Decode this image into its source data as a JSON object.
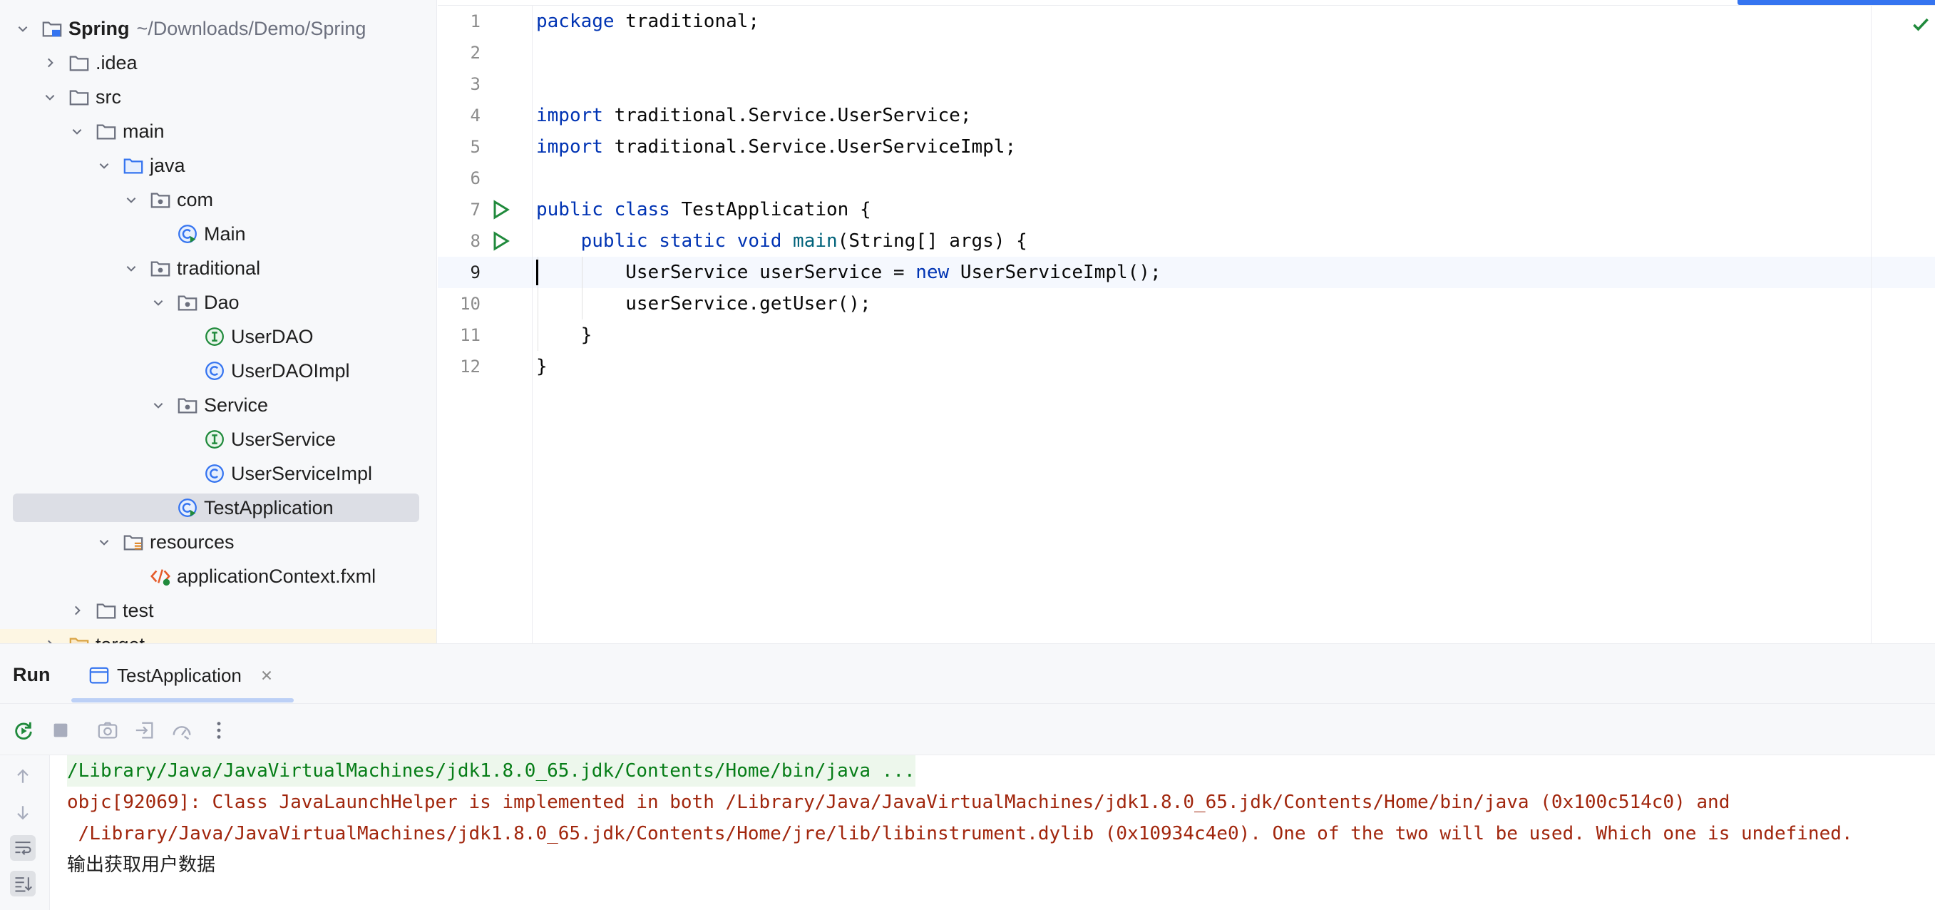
{
  "project_tree": {
    "root": {
      "name": "Spring",
      "path": "~/Downloads/Demo/Spring"
    },
    "items": [
      {
        "label": ".idea",
        "icon": "folder-icon"
      },
      {
        "label": "src",
        "icon": "folder-icon"
      },
      {
        "label": "main",
        "icon": "folder-icon"
      },
      {
        "label": "java",
        "icon": "source-folder-icon"
      },
      {
        "label": "com",
        "icon": "package-icon"
      },
      {
        "label": "Main",
        "icon": "runnable-class-icon"
      },
      {
        "label": "traditional",
        "icon": "package-icon"
      },
      {
        "label": "Dao",
        "icon": "package-icon"
      },
      {
        "label": "UserDAO",
        "icon": "interface-icon"
      },
      {
        "label": "UserDAOImpl",
        "icon": "class-icon"
      },
      {
        "label": "Service",
        "icon": "package-icon"
      },
      {
        "label": "UserService",
        "icon": "interface-icon"
      },
      {
        "label": "UserServiceImpl",
        "icon": "class-icon"
      },
      {
        "label": "TestApplication",
        "icon": "runnable-class-icon"
      },
      {
        "label": "resources",
        "icon": "resources-folder-icon"
      },
      {
        "label": "applicationContext.fxml",
        "icon": "fxml-file-icon"
      },
      {
        "label": "test",
        "icon": "folder-icon"
      },
      {
        "label": "target",
        "icon": "excluded-folder-icon"
      }
    ]
  },
  "editor": {
    "line_numbers": [
      "1",
      "2",
      "3",
      "4",
      "5",
      "6",
      "7",
      "8",
      "9",
      "10",
      "11",
      "12"
    ],
    "current_line": "9",
    "code": {
      "l1_kw": "package",
      "l1_rest": " traditional;",
      "l4_kw": "import",
      "l4_rest": " traditional.Service.UserService;",
      "l5_kw": "import",
      "l5_rest": " traditional.Service.UserServiceImpl;",
      "l7_kw": "public class",
      "l7_rest": " TestApplication {",
      "l8_indent": "    ",
      "l8_kw": "public static void",
      "l8_sp": " ",
      "l8_fn": "main",
      "l8_rest": "(String[] args) {",
      "l9_a": "        UserService userService = ",
      "l9_kw": "new",
      "l9_b": " UserServiceImpl();",
      "l10": "        userService.getUser();",
      "l11": "    }",
      "l12": "}"
    },
    "status_icon": "checkmark-icon",
    "colors": {
      "keyword": "#0033b3",
      "function": "#00627a",
      "accent": "#3574f0"
    }
  },
  "run_panel": {
    "title": "Run",
    "tab_label": "TestApplication",
    "toolbar_icons": [
      "rerun-icon",
      "stop-icon",
      "camera-icon",
      "exit-icon",
      "dashboard-icon",
      "more-icon"
    ],
    "sidebar_icons": [
      "up-arrow-icon",
      "down-arrow-icon",
      "soft-wrap-icon",
      "scroll-to-end-icon"
    ],
    "console": {
      "line1": "/Library/Java/JavaVirtualMachines/jdk1.8.0_65.jdk/Contents/Home/bin/java ...",
      "line2": "objc[92069]: Class JavaLaunchHelper is implemented in both /Library/Java/JavaVirtualMachines/jdk1.8.0_65.jdk/Contents/Home/bin/java (0x100c514c0) and",
      "line3": " /Library/Java/JavaVirtualMachines/jdk1.8.0_65.jdk/Contents/Home/jre/lib/libinstrument.dylib (0x10934c4e0). One of the two will be used. Which one is undefined.",
      "line4": "输出获取用户数据"
    }
  }
}
